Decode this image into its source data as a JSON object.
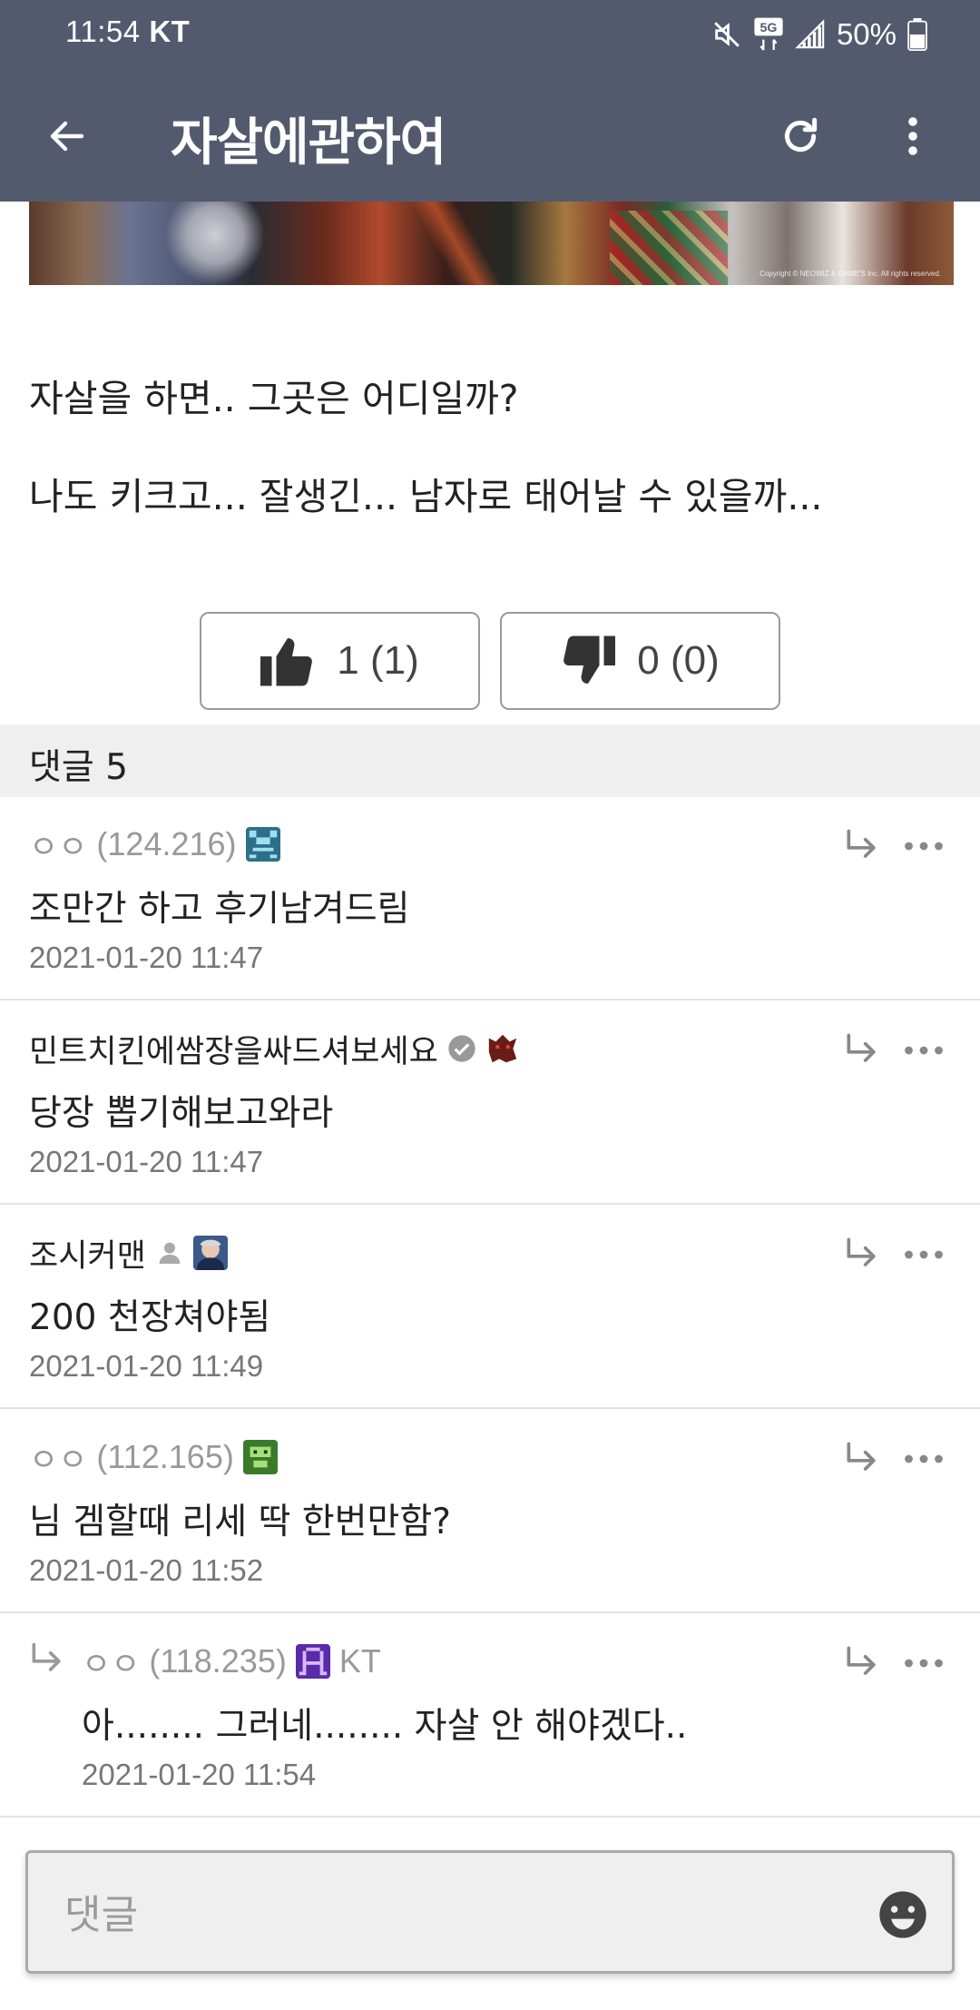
{
  "status_bar": {
    "time": "11:54",
    "carrier": "KT",
    "battery": "50%",
    "network": "5G"
  },
  "header": {
    "title": "자살에관하여"
  },
  "banner": {
    "copyright": "Copyright © NEOWIZ & GAME'S Inc. All rights reserved."
  },
  "post": {
    "lines": [
      "자살을 하면.. 그곳은 어디일까?",
      "나도 키크고... 잘생긴... 남자로 태어날 수 있을까..."
    ]
  },
  "votes": {
    "up_label": "1 (1)",
    "down_label": "0 (0)"
  },
  "comments_header": "댓글 5",
  "comments": [
    {
      "author": "ㅇㅇ",
      "ip": "(124.216)",
      "icon": "gallery-icon-blue",
      "text": "조만간 하고 후기남겨드림",
      "date": "2021-01-20 11:47"
    },
    {
      "author": "민트치킨에쌈장을싸드셔보세요",
      "ip": "",
      "icon": "gallery-icon-red",
      "text": "당장 뽑기해보고와라",
      "date": "2021-01-20 11:47"
    },
    {
      "author": "조시커맨",
      "ip": "",
      "icon": "gallery-icon-portrait",
      "text": "200 천장쳐야됨",
      "date": "2021-01-20 11:49"
    },
    {
      "author": "ㅇㅇ",
      "ip": "(112.165)",
      "icon": "gallery-icon-green",
      "text": "님 겜할때 리세 딱 한번만함?",
      "date": "2021-01-20 11:52"
    },
    {
      "author": "ㅇㅇ",
      "ip": "(118.235)",
      "icon": "gallery-icon-purple",
      "carrier": "KT",
      "text": "아........ 그러네........ 자살 안 해야겠다..",
      "date": "2021-01-20 11:54"
    }
  ],
  "input": {
    "placeholder": "댓글"
  },
  "colors": {
    "header_bg": "#545a6e",
    "comments_header_bg": "#efefef"
  }
}
